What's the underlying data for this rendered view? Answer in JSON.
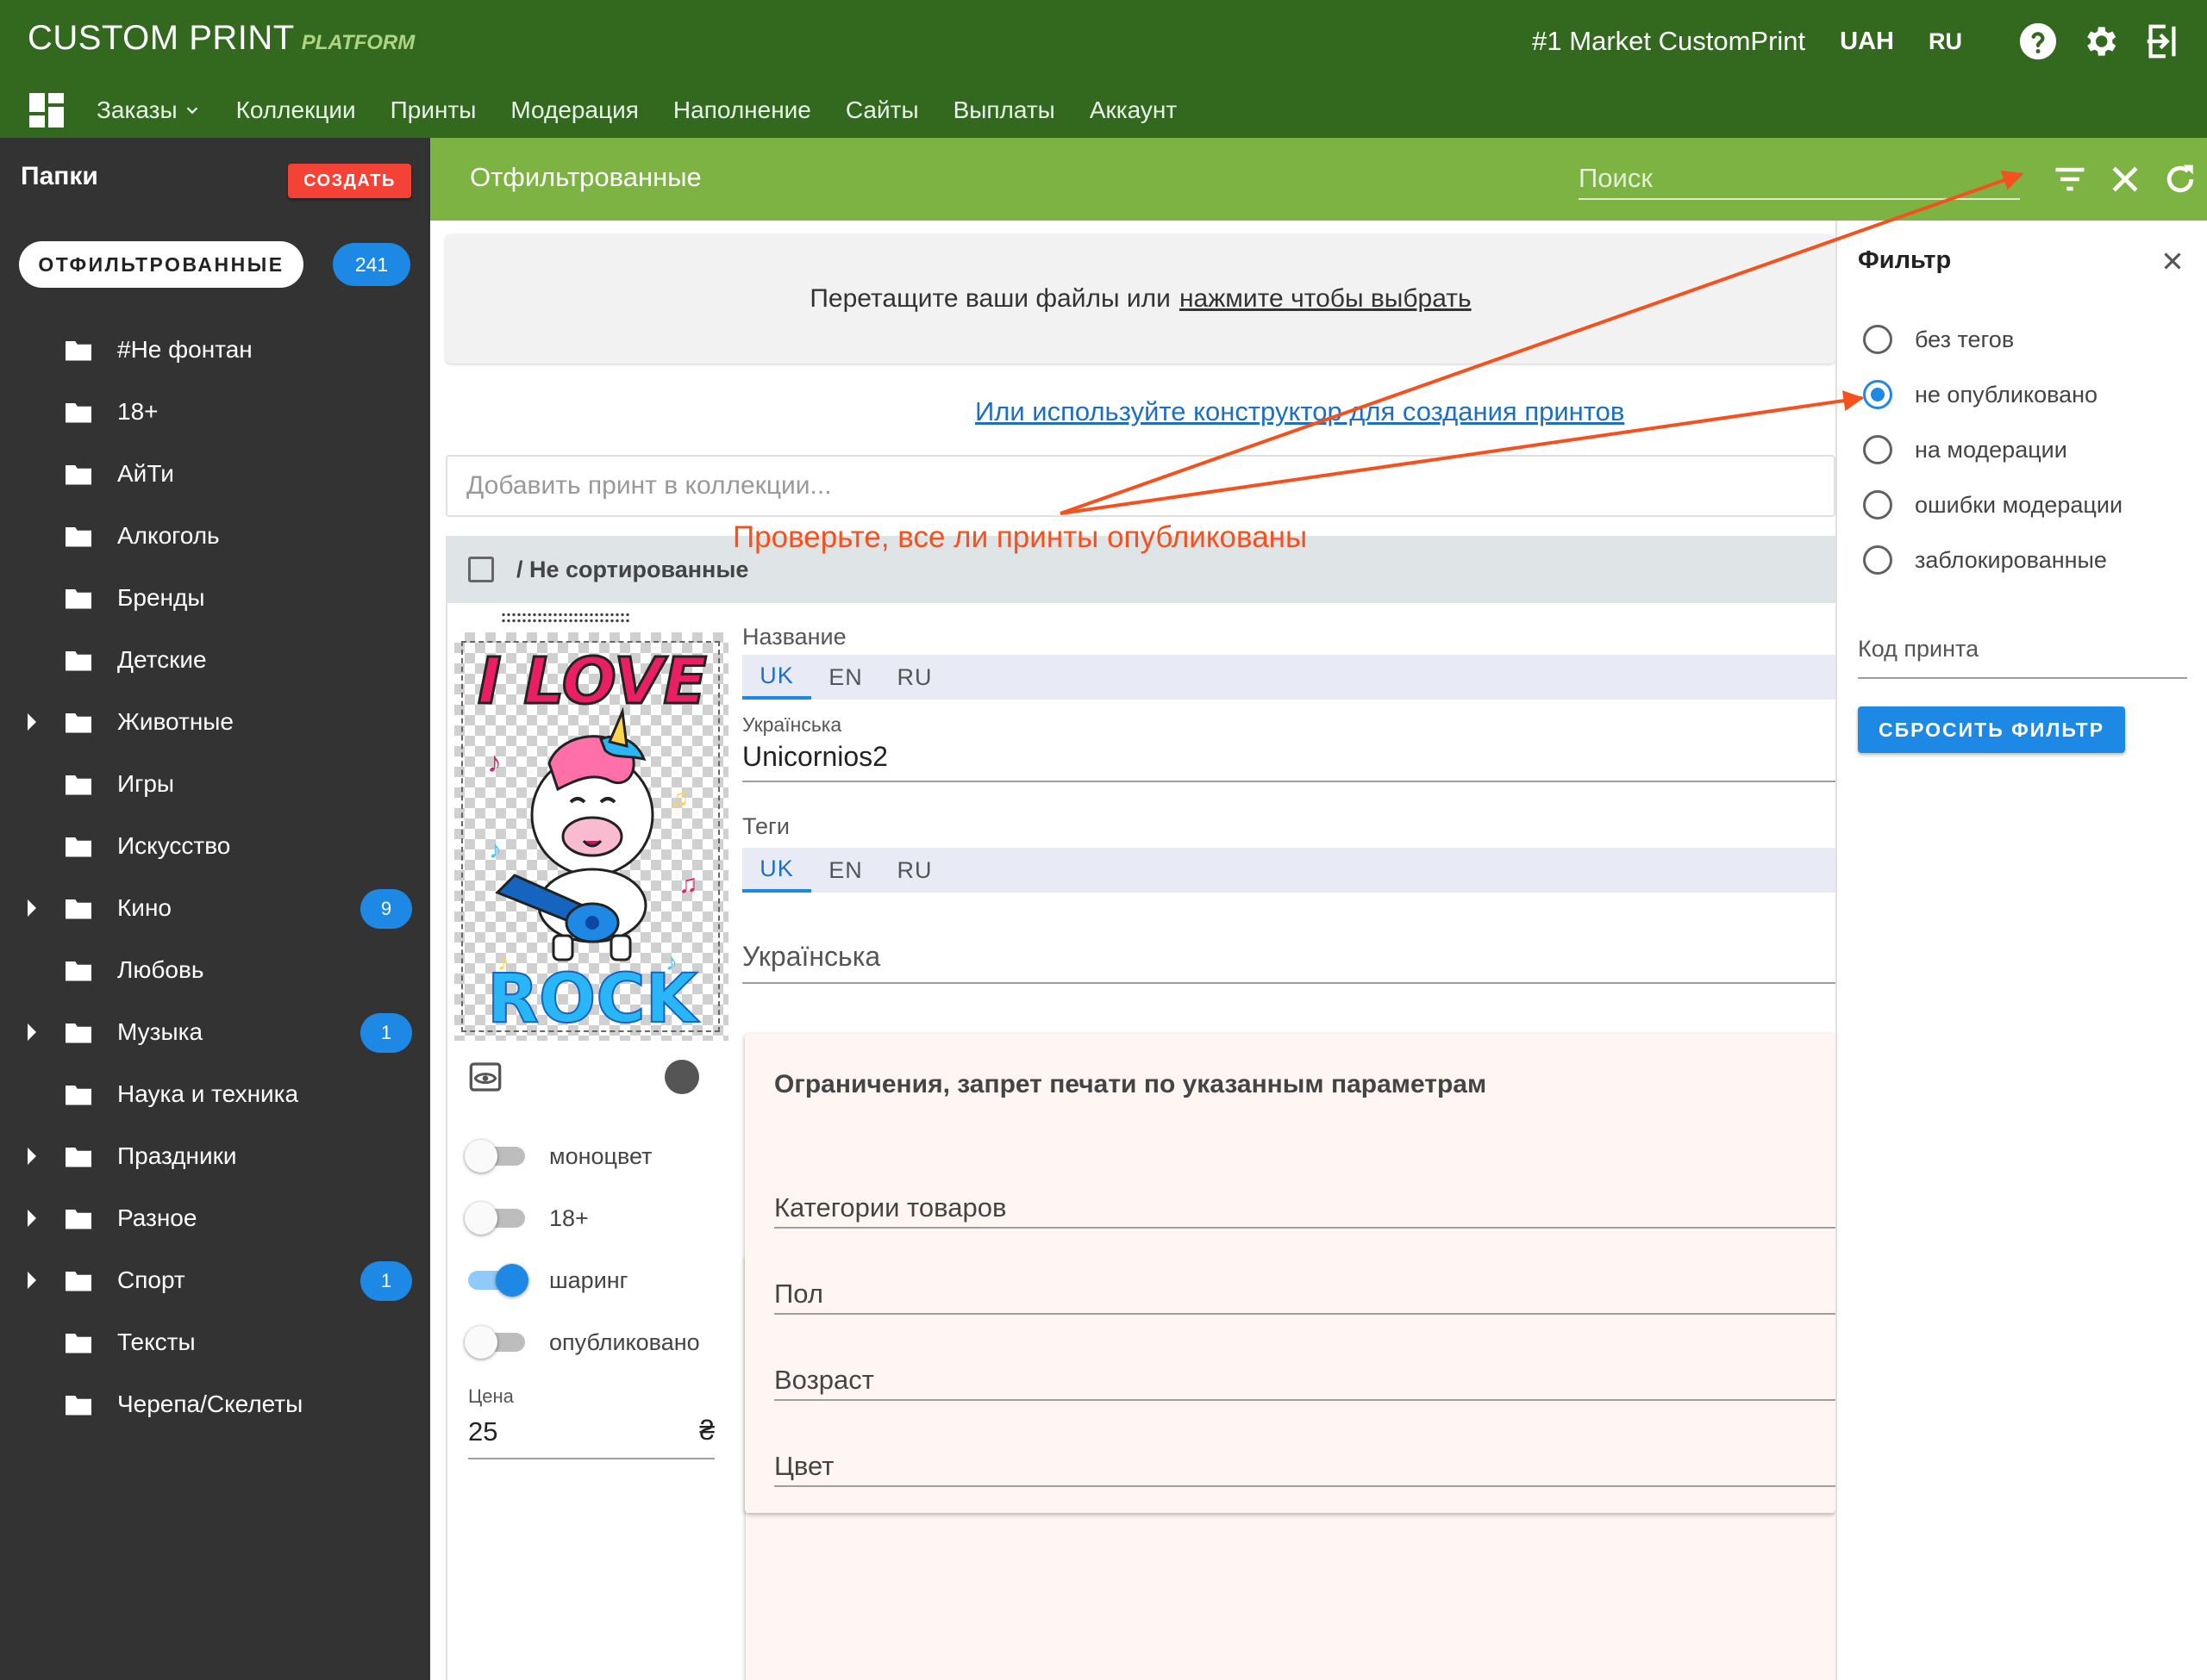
{
  "topbar": {
    "brand": "CUSTOM PRINT",
    "brand_sub": "PLATFORM",
    "market": "#1 Market CustomPrint",
    "currency": "UAH",
    "language": "RU",
    "icons": [
      "help-icon",
      "gear-icon",
      "logout-icon"
    ]
  },
  "nav": {
    "items": [
      "Заказы",
      "Коллекции",
      "Принты",
      "Модерация",
      "Наполнение",
      "Сайты",
      "Выплаты",
      "Аккаунт"
    ]
  },
  "sidebar": {
    "title": "Папки",
    "create_label": "СОЗДАТЬ",
    "filtered_chip": "ОТФИЛЬТРОВАННЫЕ",
    "filtered_count": "241",
    "folders": [
      {
        "name": "#Не фонтан",
        "expandable": false,
        "count": ""
      },
      {
        "name": "18+",
        "expandable": false,
        "count": ""
      },
      {
        "name": "АйТи",
        "expandable": false,
        "count": ""
      },
      {
        "name": "Алкоголь",
        "expandable": false,
        "count": ""
      },
      {
        "name": "Бренды",
        "expandable": false,
        "count": ""
      },
      {
        "name": "Детские",
        "expandable": false,
        "count": ""
      },
      {
        "name": "Животные",
        "expandable": true,
        "count": ""
      },
      {
        "name": "Игры",
        "expandable": false,
        "count": ""
      },
      {
        "name": "Искусство",
        "expandable": false,
        "count": ""
      },
      {
        "name": "Кино",
        "expandable": true,
        "count": "9"
      },
      {
        "name": "Любовь",
        "expandable": false,
        "count": ""
      },
      {
        "name": "Музыка",
        "expandable": true,
        "count": "1"
      },
      {
        "name": "Наука и техника",
        "expandable": false,
        "count": ""
      },
      {
        "name": "Праздники",
        "expandable": true,
        "count": ""
      },
      {
        "name": "Разное",
        "expandable": true,
        "count": ""
      },
      {
        "name": "Спорт",
        "expandable": true,
        "count": "1"
      },
      {
        "name": "Тексты",
        "expandable": false,
        "count": ""
      },
      {
        "name": "Черепа/Скелеты",
        "expandable": false,
        "count": ""
      }
    ]
  },
  "header": {
    "title": "Отфильтрованные",
    "search_placeholder": "Поиск"
  },
  "main": {
    "dropzone_text": "Перетащите ваши файлы или",
    "dropzone_link": "нажмите чтобы выбрать",
    "constructor_link": "Или используйте конструктор для создания принтов",
    "add_placeholder": "Добавить принт в коллекции...",
    "group_title": "/ Не сортированные"
  },
  "print": {
    "image_text_top": "I LOVE",
    "image_text_bottom": "ROCK",
    "name_label": "Название",
    "lang_tabs": [
      "UK",
      "EN",
      "RU"
    ],
    "name_lang_label": "Українська",
    "name_value": "Unicornios2",
    "tags_label": "Теги",
    "tags_placeholder": "Українська",
    "toggles": [
      {
        "label": "моноцвет",
        "on": false
      },
      {
        "label": "18+",
        "on": false
      },
      {
        "label": "шаринг",
        "on": true
      },
      {
        "label": "опубликовано",
        "on": false
      }
    ],
    "price_label": "Цена",
    "price_value": "25",
    "currency_symbol": "₴"
  },
  "restrictions": {
    "title": "Ограничения, запрет печати по указанным параметрам",
    "fields": [
      "Категории товаров",
      "Пол",
      "Возраст",
      "Цвет"
    ]
  },
  "filter": {
    "title": "Фильтр",
    "options": [
      {
        "label": "без тегов",
        "selected": false
      },
      {
        "label": "не опубликовано",
        "selected": true
      },
      {
        "label": "на модерации",
        "selected": false
      },
      {
        "label": "ошибки модерации",
        "selected": false
      },
      {
        "label": "заблокированные",
        "selected": false
      }
    ],
    "code_label": "Код принта",
    "reset_label": "СБРОСИТЬ ФИЛЬТР"
  },
  "annotation": {
    "text": "Проверьте, все ли принты опубликованы"
  },
  "colors": {
    "topbar": "#33691e",
    "header": "#7cb342",
    "sidebar": "#333333",
    "accent": "#1e88e5",
    "create": "#f44336",
    "annotation": "#f4511e"
  }
}
